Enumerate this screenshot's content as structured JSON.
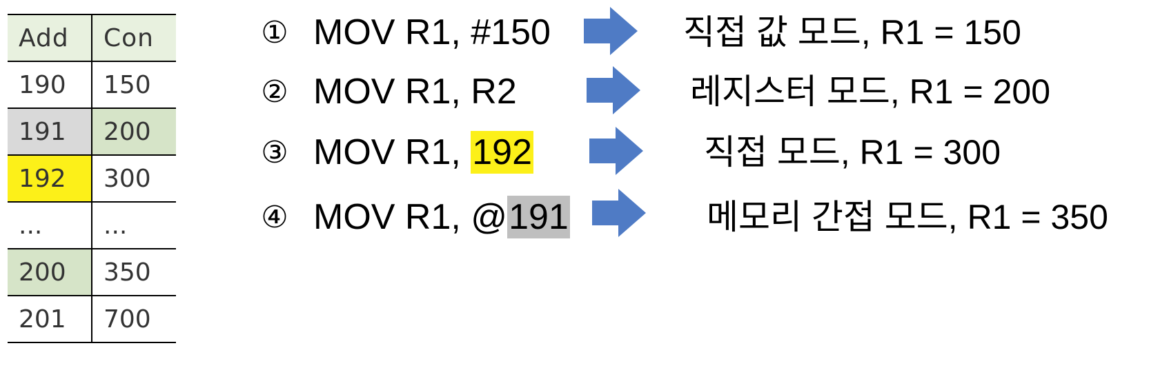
{
  "memory_table": {
    "headers": [
      "Add",
      "Con"
    ],
    "rows": [
      {
        "addr": "190",
        "con": "150"
      },
      {
        "addr": "191",
        "con": "200"
      },
      {
        "addr": "192",
        "con": "300"
      },
      {
        "addr": "...",
        "con": "..."
      },
      {
        "addr": "200",
        "con": "350"
      },
      {
        "addr": "201",
        "con": "700"
      }
    ]
  },
  "instructions": [
    {
      "num": "①",
      "code": "MOV R1, ",
      "operand": "#150",
      "result": "직접 값 모드,  R1 = 150"
    },
    {
      "num": "②",
      "code": "MOV R1, ",
      "operand": "R2",
      "result": "레지스터 모드,  R1 = 200"
    },
    {
      "num": "③",
      "code": "MOV R1, ",
      "operand": "192",
      "result": "직접 모드,  R1 = 300"
    },
    {
      "num": "④",
      "code": "MOV R1, @",
      "operand": "191",
      "result": "메모리 간접 모드,  R1 = 350"
    }
  ],
  "colors": {
    "arrow": "#4f7bc5",
    "header_bg": "#e8f1df",
    "highlight_gray": "#d9d9d9",
    "highlight_green": "#d6e4c8",
    "highlight_yellow": "#fcf019"
  }
}
